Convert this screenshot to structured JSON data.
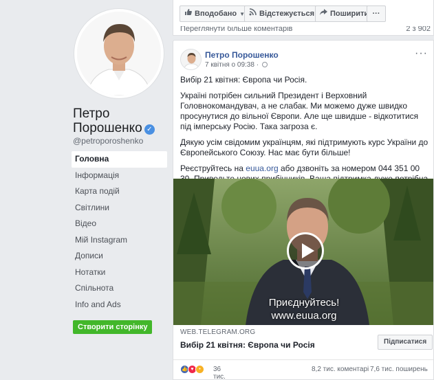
{
  "profile": {
    "name_line1": "Петро",
    "name_line2": "Порошенко",
    "handle": "@petroporoshenko"
  },
  "nav": {
    "items": [
      {
        "label": "Головна"
      },
      {
        "label": "Інформація"
      },
      {
        "label": "Карта подій"
      },
      {
        "label": "Світлини"
      },
      {
        "label": "Відео"
      },
      {
        "label": "Мій Instagram"
      },
      {
        "label": "Дописи"
      },
      {
        "label": "Нотатки"
      },
      {
        "label": "Спільнота"
      },
      {
        "label": "Info and Ads"
      }
    ],
    "create_page_label": "Створити сторінку"
  },
  "actionbar": {
    "liked_label": "Вподобано",
    "follow_label": "Відстежується",
    "share_label": "Поширити",
    "more_label": "···",
    "prev_comments_label": "Переглянути більше коментарів",
    "prev_comments_count": "2 з 902"
  },
  "post": {
    "author": "Петро Порошенко",
    "timestamp": "7 квітня о 09:38",
    "more_label": "···",
    "paragraph1": "Вибір 21 квітня: Європа чи Росія.",
    "paragraph2": "Україні потрібен сильний Президент і Верховний Головнокомандувач, а не слабак. Ми можемо дуже швидко просунутися до вільної Європи. Але ще швидше - відкотитися під імперську Росію. Така загроза є.",
    "paragraph3": "Дякую усім свідомим українцям, які підтримують курс України до Європейського Союзу. Нас має бути більше!",
    "paragraph4_before": "Реєструйтесь на ",
    "paragraph4_link": "euua.org",
    "paragraph4_after": " або дзвоніть за номером 044 351 00 30. Приводьте нових прибічників. Ваша підтримка дуже потрібна – приєднуйтеся!",
    "video_caption_line1": "Приєднуйтесь!",
    "video_caption_line2": "www.euua.org",
    "link_domain": "WEB.TELEGRAM.ORG",
    "link_title": "Вибір 21 квітня: Європа чи Росія",
    "subscribe_label": "Підписатися",
    "reactions_count": "36 тис.",
    "comments_count": "8,2 тис. коментарі",
    "shares_count": "7,6 тис. поширень"
  },
  "colors": {
    "page_bg": "#e9ebee",
    "link": "#365899",
    "create_button": "#42b72a",
    "verified": "#4a90e2"
  },
  "icons": {
    "like": "thumbs-up-icon",
    "follow": "rss-icon",
    "share": "share-arrow-icon",
    "verified": "verified-check-icon",
    "privacy": "globe-icon",
    "play": "play-icon"
  }
}
